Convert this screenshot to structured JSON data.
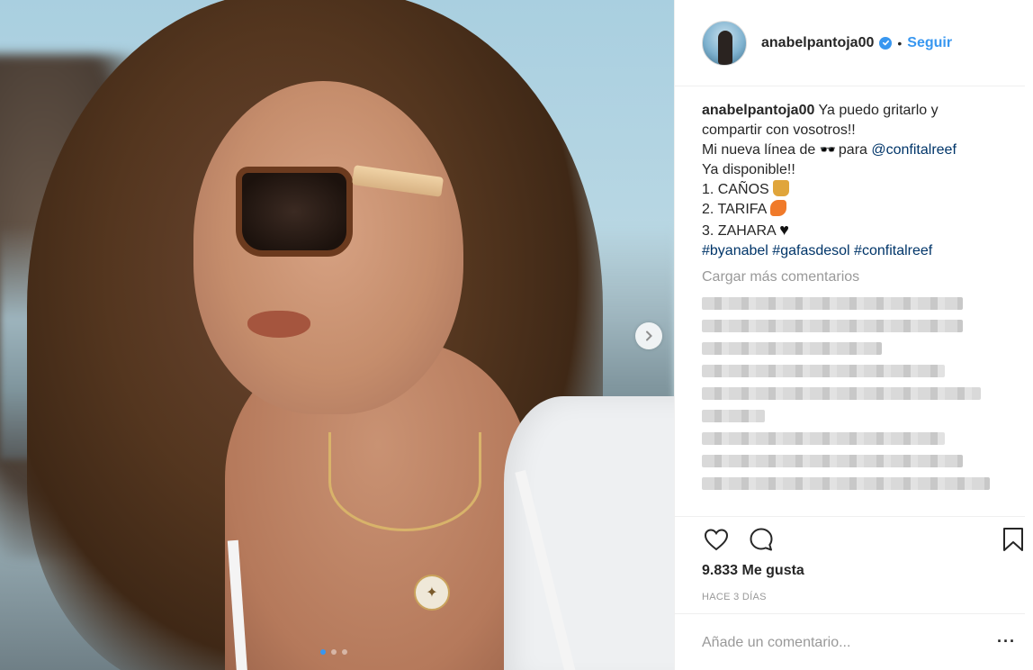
{
  "post": {
    "carousel": {
      "dot_count": 3,
      "active_index": 0
    },
    "accent_color": "#3897f0"
  },
  "header": {
    "username": "anabelpantoja00",
    "separator": "•",
    "follow_label": "Seguir"
  },
  "caption": {
    "username": "anabelpantoja00",
    "line1_text": "Ya puedo gritarlo y compartir con vosotros!!",
    "line2_prefix": "Mi nueva línea de",
    "line2_emoji": "🕶️",
    "line2_mid": "para",
    "line2_mention": "@confitalreef",
    "line3": "Ya disponible!!",
    "item1": "1. CAÑOS",
    "item2": "2. TARIFA",
    "item3": "3. ZAHARA",
    "hashtag1": "#byanabel",
    "hashtag2": "#gafasdesol",
    "hashtag3": "#confitalreef"
  },
  "comments": {
    "load_more": "Cargar más comentarios"
  },
  "actions": {
    "likes": "9.833 Me gusta",
    "timestamp": "HACE 3 DÍAS"
  },
  "comment_box": {
    "placeholder": "Añade un comentario...",
    "more_label": "···"
  },
  "icons": {
    "next": "chevron-right-icon",
    "like": "heart-icon",
    "comment": "comment-bubble-icon",
    "save": "bookmark-icon",
    "verified": "verified-badge-icon"
  }
}
